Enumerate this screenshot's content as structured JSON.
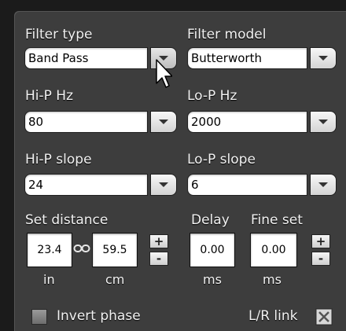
{
  "filter": {
    "type_label": "Filter type",
    "type_value": "Band Pass",
    "model_label": "Filter model",
    "model_value": "Butterworth"
  },
  "highpass": {
    "hz_label": "Hi-P Hz",
    "hz_value": "80",
    "slope_label": "Hi-P slope",
    "slope_value": "24"
  },
  "lowpass": {
    "hz_label": "Lo-P Hz",
    "hz_value": "2000",
    "slope_label": "Lo-P slope",
    "slope_value": "6"
  },
  "distance": {
    "label": "Set distance",
    "inches_value": "23.4",
    "cm_value": "59.5",
    "inches_unit": "in",
    "cm_unit": "cm",
    "plus": "+",
    "minus": "-"
  },
  "delay": {
    "label": "Delay",
    "value": "0.00",
    "unit": "ms"
  },
  "fine_set": {
    "label": "Fine set",
    "value": "0.00",
    "unit": "ms",
    "plus": "+",
    "minus": "-"
  },
  "invert_phase": {
    "label": "Invert phase",
    "checked": false
  },
  "lr_link": {
    "label": "L/R link",
    "checked": true
  }
}
